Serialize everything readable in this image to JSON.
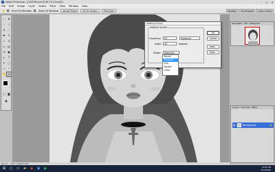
{
  "window": {
    "title": "Adobe Photoshop - [CYNTHIA.psd @ 66.7% (Gray/8)]",
    "minimize": "–",
    "maximize": "□",
    "close": "✕"
  },
  "menu": [
    "File",
    "Edit",
    "Image",
    "Layer",
    "Select",
    "Filter",
    "View",
    "Window",
    "Help"
  ],
  "options_bar": {
    "tool_label": "Scroll All Windows",
    "zoom_label": "Zoom All Windows",
    "buttons": [
      "Actual Pixels",
      "Fit On Screen",
      "Print Size"
    ]
  },
  "palette_well": [
    "Brushes",
    "Tool Presets",
    "Layer Comps"
  ],
  "status": {
    "zoom": "66.7%",
    "doc": "Doc: 1.44M/1.44M"
  },
  "dialog": {
    "title": "Halftone Screen",
    "group": "Halftone Screen",
    "frequency_label": "Frequency:",
    "frequency_value": "53",
    "frequency_unit": "lines/inch",
    "angle_label": "Angle:",
    "angle_value": "45",
    "angle_unit": "degrees",
    "shape_label": "Shape:",
    "shape_value": "Diamond",
    "shape_options": [
      "Round",
      "Elliptical",
      "Line",
      "Square",
      "Cross"
    ],
    "shape_selected_index": 1,
    "buttons": [
      "OK",
      "Cancel",
      "Load...",
      "Save..."
    ]
  },
  "navigator": {
    "tabs": [
      "Navigator",
      "Info",
      "Histogram"
    ]
  },
  "layers": {
    "tabs": [
      "Layers",
      "Channels",
      "Paths"
    ],
    "layer_name": "Background"
  },
  "taskbar": {
    "time": "10:35 PM",
    "date": "9/12/2020"
  },
  "colors": {
    "selection": "#3399ff",
    "layer_highlight": "#3a6fd8",
    "taskbar": "#17233b"
  }
}
